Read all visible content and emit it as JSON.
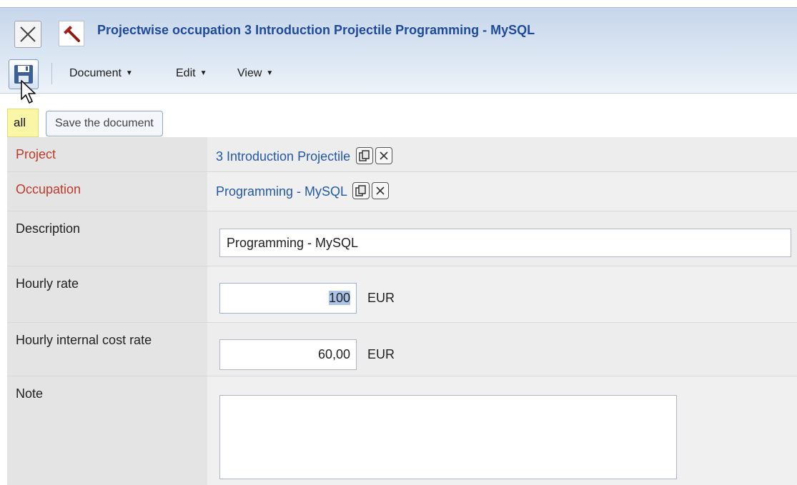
{
  "window": {
    "title": "Projectwise occupation 3 Introduction Projectile Programming - MySQL"
  },
  "toolbar": {
    "menus": [
      {
        "label": "Document",
        "caret": "▼"
      },
      {
        "label": "Edit",
        "caret": "▼"
      },
      {
        "label": "View",
        "caret": "▼"
      }
    ],
    "save_tooltip": "Save the document"
  },
  "tabs": {
    "active": "all"
  },
  "form": {
    "project": {
      "label": "Project",
      "value": "3 Introduction Projectile"
    },
    "occupation": {
      "label": "Occupation",
      "value": "Programming - MySQL"
    },
    "description": {
      "label": "Description",
      "value": "Programming - MySQL"
    },
    "hourly_rate": {
      "label": "Hourly rate",
      "value": "100",
      "currency": "EUR"
    },
    "hourly_internal_cost_rate": {
      "label": "Hourly internal cost rate",
      "value": "60,00",
      "currency": "EUR"
    },
    "note": {
      "label": "Note",
      "value": ""
    }
  },
  "colors": {
    "title": "#1f4a9a",
    "link": "#2358a8",
    "required_label": "#c0392b",
    "tab_highlight": "#faf6a8",
    "selection": "#aac4ea"
  },
  "icons": [
    "close-icon",
    "hammer-icon",
    "save-icon",
    "cursor-icon",
    "copy-icon",
    "clear-icon"
  ]
}
